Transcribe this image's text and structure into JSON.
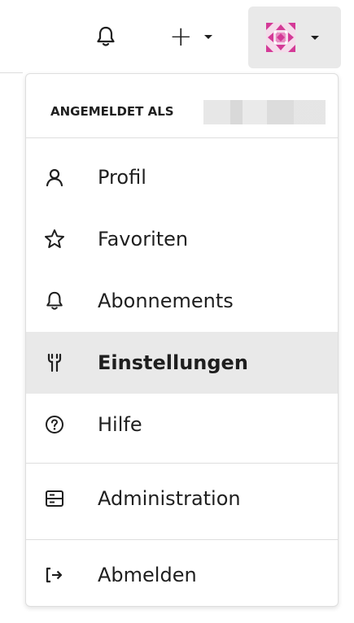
{
  "topbar": {
    "notifications_icon": "bell-icon",
    "create_icon": "plus-icon",
    "create_glyph": "+",
    "avatar_icon": "identicon-avatar",
    "avatar_color": "#d43a97"
  },
  "menu": {
    "signed_in_label": "ANGEMELDET ALS",
    "items": [
      {
        "label": "Profil",
        "icon": "user-icon"
      },
      {
        "label": "Favoriten",
        "icon": "star-icon"
      },
      {
        "label": "Abonnements",
        "icon": "bell-icon"
      },
      {
        "label": "Einstellungen",
        "icon": "tools-icon",
        "active": true
      },
      {
        "label": "Hilfe",
        "icon": "help-icon"
      },
      {
        "label": "Administration",
        "icon": "server-icon"
      },
      {
        "label": "Abmelden",
        "icon": "sign-out-icon"
      }
    ]
  },
  "colors": {
    "active_bg": "#e9e9e9",
    "border": "#dedede",
    "text": "#1f1f1f"
  }
}
